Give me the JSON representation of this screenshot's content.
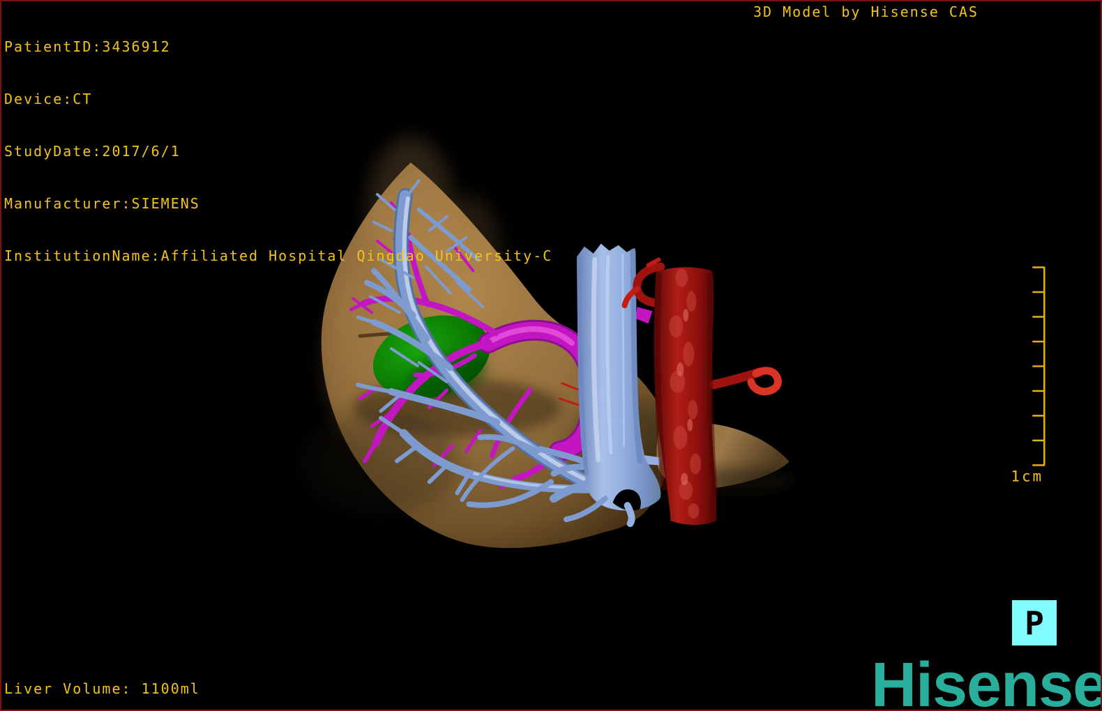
{
  "header": {
    "patient_info": [
      "PatientID:3436912",
      "Device:CT",
      "StudyDate:2017/6/1",
      "Manufacturer:SIEMENS",
      "InstitutionName:Affiliated Hospital Qingdao University-C"
    ],
    "title": "3D Model by Hisense CAS"
  },
  "footer": {
    "liver_volume": "Liver Volume: 1100ml",
    "brand": "Hisense"
  },
  "viewport": {
    "orientation_marker": "P",
    "scale_bar": {
      "label": "1cm",
      "tick_count": 9
    },
    "structures": [
      {
        "name": "liver",
        "color": "#96713f"
      },
      {
        "name": "hepatic-veins",
        "color": "#7e9bd0"
      },
      {
        "name": "portal-veins",
        "color": "#c316c3"
      },
      {
        "name": "tumor",
        "color": "#0e8f05"
      },
      {
        "name": "inferior-vena-cava",
        "color": "#93b0e0"
      },
      {
        "name": "aorta-hepatic-artery",
        "color": "#9e130e"
      }
    ]
  },
  "colors": {
    "background": "#000000",
    "border_red": "#7a1414",
    "gold": "#f2c21d",
    "scale_bar": "#e8af0e",
    "brand_teal": "#28ae9b",
    "p_button_bg": "#80fbff",
    "p_button_fg": "#000000",
    "liver": "#96713f",
    "liver_highlight": "#be9458",
    "liver_shadow": "#3c2b14",
    "hepatic_vein": "#7e9bd0",
    "hepatic_vein_highlight": "#c6d4ee",
    "hepatic_vein_dark": "#55719f",
    "portal_vein": "#c316c3",
    "portal_vein_highlight": "#e858df",
    "portal_vein_dark": "#8f0d92",
    "tumor": "#0e8f05",
    "ivc": "#93b0e0",
    "ivc_highlight": "#c9d8f2",
    "ivc_dark": "#6a87bf",
    "aorta": "#9e130e",
    "aorta_dark": "#5a0705",
    "artery": "#c21d12",
    "artery_bright": "#d93425"
  }
}
